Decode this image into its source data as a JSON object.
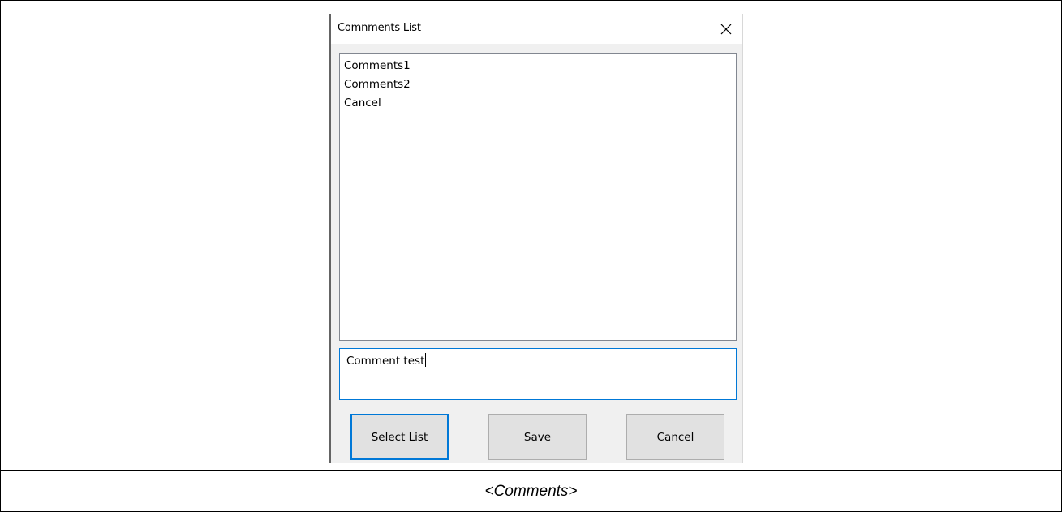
{
  "dialog": {
    "title": "Comnments List",
    "list_items": [
      "Comments1",
      "Comments2",
      "Cancel"
    ],
    "comment_value": "Comment test",
    "buttons": {
      "select_list": "Select List",
      "save": "Save",
      "cancel": "Cancel"
    },
    "icons": {
      "close": "close-icon"
    },
    "colors": {
      "focus_border": "#0078d7",
      "button_face": "#e1e1e1",
      "window_bg": "#f0f0f0"
    }
  },
  "caption": "<Comments>"
}
